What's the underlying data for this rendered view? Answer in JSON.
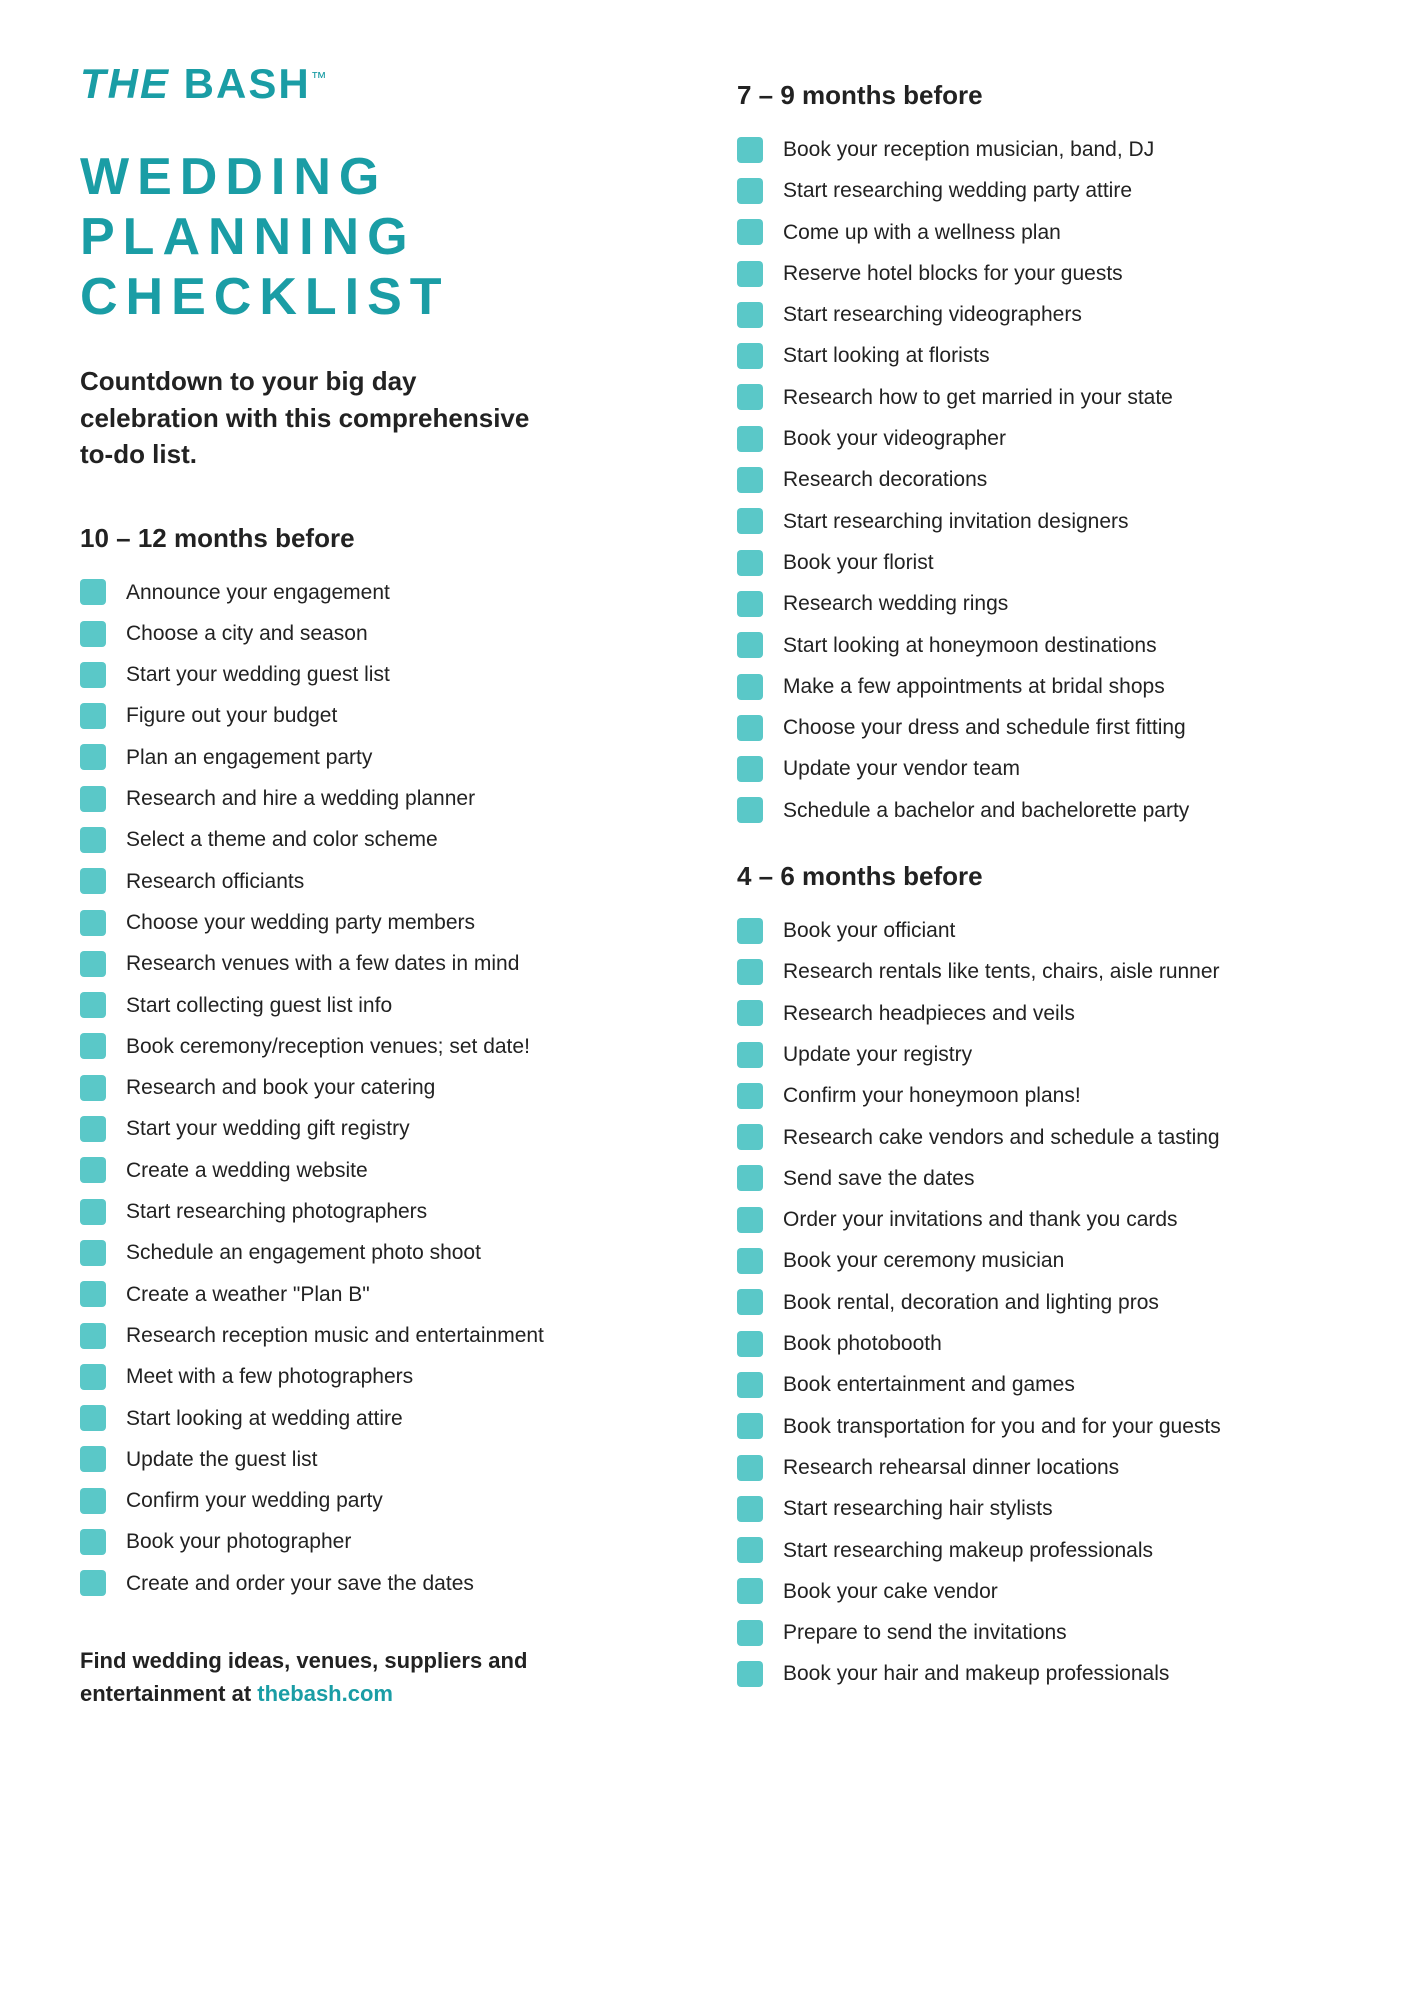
{
  "logo": {
    "text": "THE BASH",
    "tm": "™"
  },
  "title": "WEDDING PLANNING CHECKLIST",
  "subtitle": "Countdown to your big day celebration with this comprehensive to-do list.",
  "sections": {
    "left": [
      {
        "heading": "10 – 12 months before",
        "items": [
          "Announce your engagement",
          "Choose a city and season",
          "Start your wedding guest list",
          "Figure out your budget",
          "Plan an engagement party",
          "Research and hire a wedding planner",
          "Select a theme and color scheme",
          "Research officiants",
          "Choose your wedding party members",
          "Research venues with a few dates in mind",
          "Start collecting guest list info",
          "Book ceremony/reception venues; set date!",
          "Research and book your catering",
          "Start your wedding gift registry",
          "Create a wedding website",
          "Start researching photographers",
          "Schedule an engagement photo shoot",
          "Create a weather \"Plan B\"",
          "Research reception music and entertainment",
          "Meet with a few photographers",
          "Start looking at wedding attire",
          "Update the guest list",
          "Confirm your wedding party",
          "Book your photographer",
          "Create and order your save the dates"
        ]
      }
    ],
    "right": [
      {
        "heading": "7 – 9 months before",
        "items": [
          "Book your reception musician, band, DJ",
          "Start researching wedding party attire",
          "Come up with a wellness plan",
          "Reserve hotel blocks for your guests",
          "Start researching videographers",
          "Start looking at florists",
          "Research how to get married in your state",
          "Book your videographer",
          "Research decorations",
          "Start researching invitation designers",
          "Book your florist",
          "Research wedding rings",
          "Start looking at honeymoon destinations",
          "Make a few appointments at bridal shops",
          "Choose your dress and schedule first fitting",
          "Update your vendor team",
          "Schedule a bachelor and bachelorette party"
        ]
      },
      {
        "heading": "4 – 6 months before",
        "items": [
          "Book your officiant",
          "Research rentals like tents, chairs, aisle runner",
          "Research headpieces and veils",
          "Update your registry",
          "Confirm your honeymoon plans!",
          "Research cake vendors and schedule a tasting",
          "Send save the dates",
          "Order your invitations and thank you cards",
          "Book your ceremony musician",
          "Book rental, decoration and lighting pros",
          "Book photobooth",
          "Book entertainment and games",
          "Book transportation for you and for your guests",
          "Research rehearsal dinner locations",
          "Start researching hair stylists",
          "Start researching makeup professionals",
          "Book your cake vendor",
          "Prepare to send the invitations",
          "Book your hair and makeup professionals"
        ]
      }
    ]
  },
  "footer": {
    "text": "Find wedding ideas, venues, suppliers and entertainment at ",
    "link_text": "thebash.com"
  }
}
